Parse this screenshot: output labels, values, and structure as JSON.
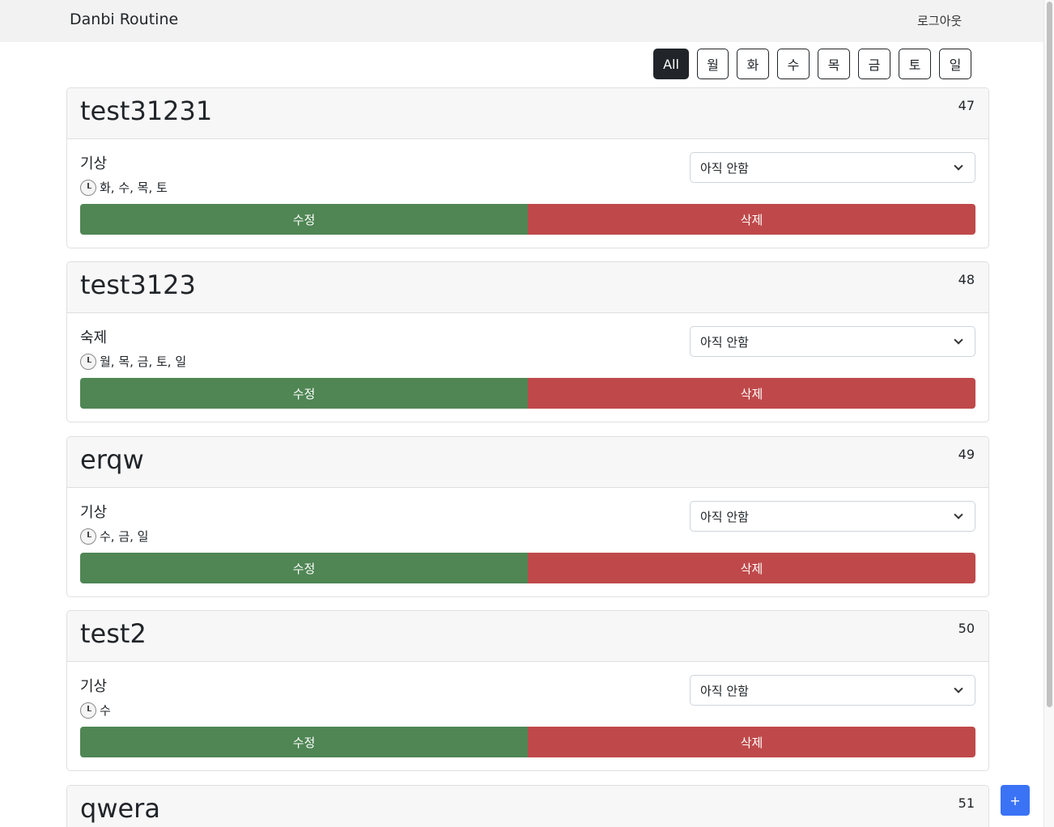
{
  "navbar": {
    "brand": "Danbi Routine",
    "logout": "로그아웃"
  },
  "day_filter": [
    {
      "label": "All",
      "active": true
    },
    {
      "label": "월",
      "active": false
    },
    {
      "label": "화",
      "active": false
    },
    {
      "label": "수",
      "active": false
    },
    {
      "label": "목",
      "active": false
    },
    {
      "label": "금",
      "active": false
    },
    {
      "label": "토",
      "active": false
    },
    {
      "label": "일",
      "active": false
    }
  ],
  "routines": [
    {
      "title": "test31231",
      "id": "47",
      "category": "기상",
      "days": "화, 수, 목, 토",
      "status": "아직 안함",
      "edit_label": "수정",
      "delete_label": "삭제"
    },
    {
      "title": "test3123",
      "id": "48",
      "category": "숙제",
      "days": "월, 목, 금, 토, 일",
      "status": "아직 안함",
      "edit_label": "수정",
      "delete_label": "삭제"
    },
    {
      "title": "erqw",
      "id": "49",
      "category": "기상",
      "days": "수, 금, 일",
      "status": "아직 안함",
      "edit_label": "수정",
      "delete_label": "삭제"
    },
    {
      "title": "test2",
      "id": "50",
      "category": "기상",
      "days": "수",
      "status": "아직 안함",
      "edit_label": "수정",
      "delete_label": "삭제"
    },
    {
      "title": "qwera",
      "id": "51",
      "category": "",
      "days": "",
      "status": "",
      "edit_label": "",
      "delete_label": ""
    }
  ],
  "add_button": "+",
  "colors": {
    "edit": "#4f8654",
    "delete": "#bf494a",
    "add": "#3a73f5",
    "active_filter": "#212529"
  }
}
